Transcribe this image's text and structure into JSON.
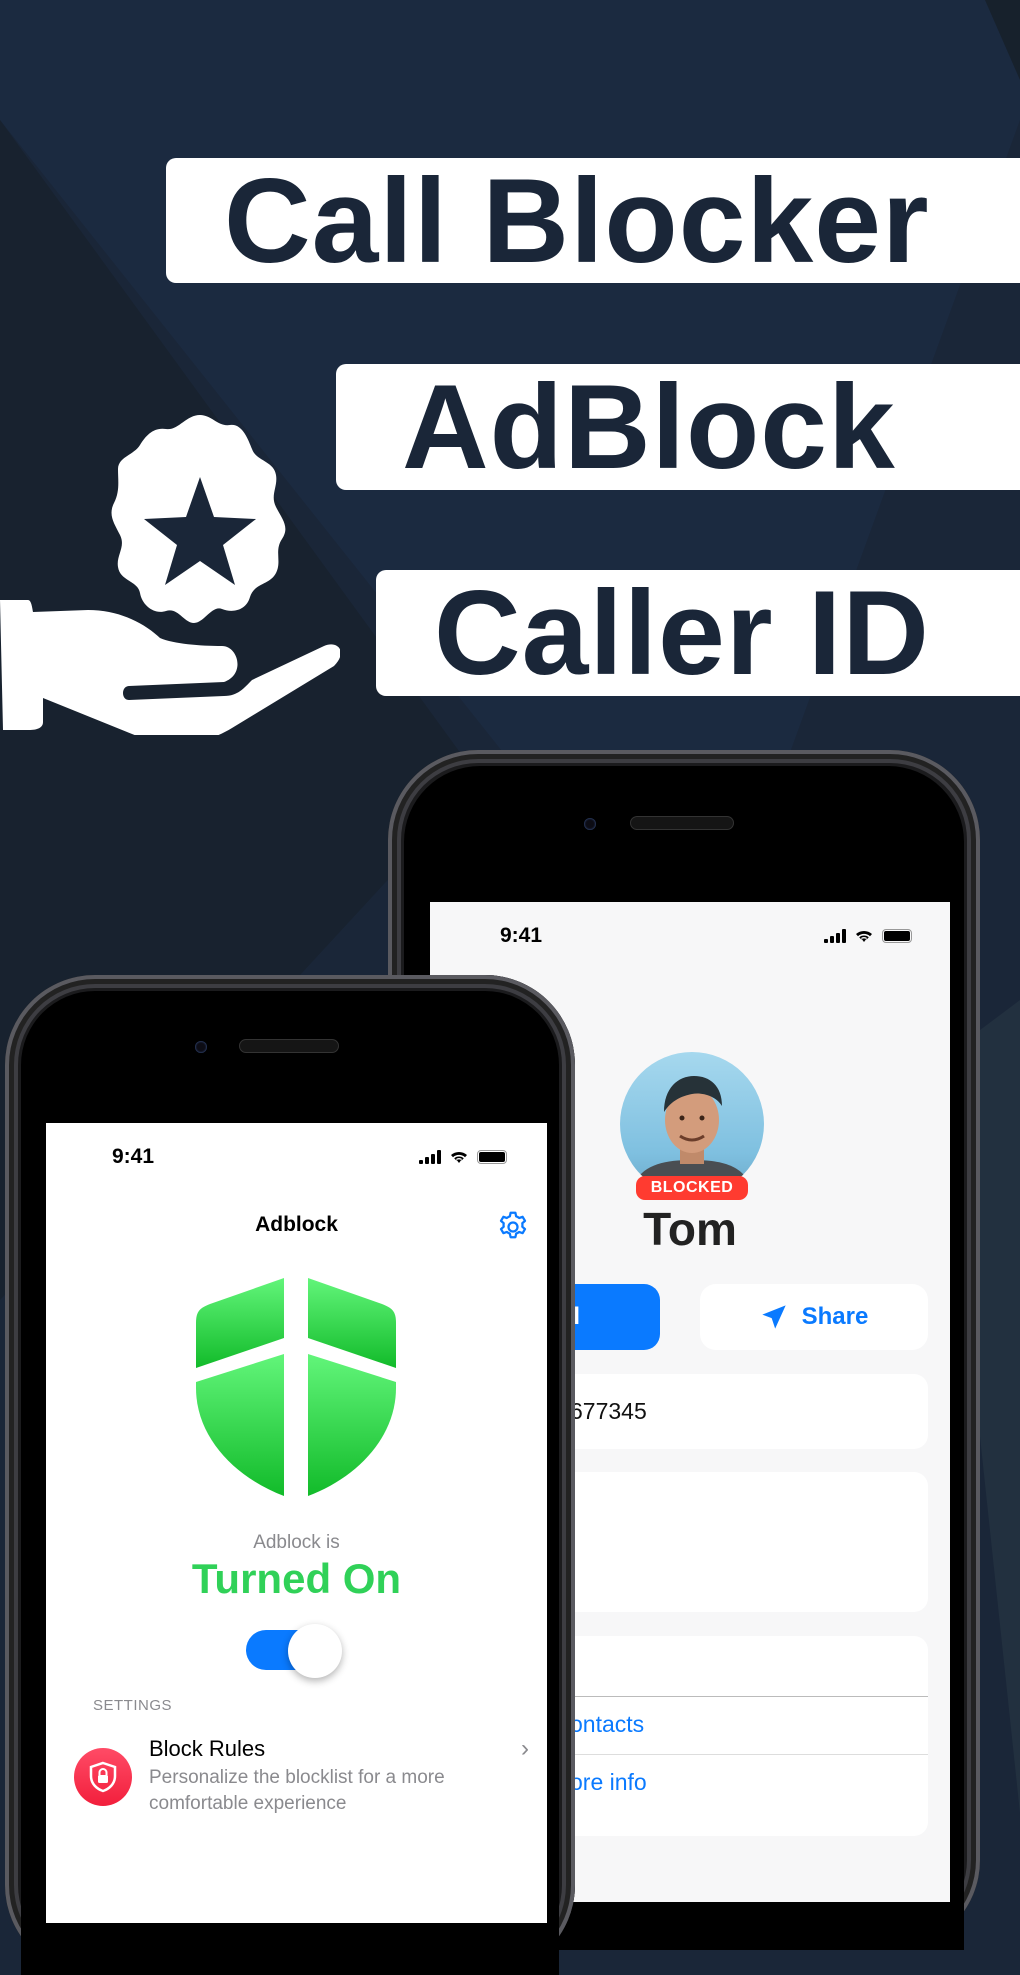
{
  "banner": {
    "lines": [
      "Call Blocker",
      "AdBlock",
      "Caller ID"
    ],
    "hero_icon": "hand-holding-star-badge-icon",
    "colors": {
      "background": "#1a2638",
      "band": "#ffffff",
      "text": "#1a2638"
    }
  },
  "caller_phone": {
    "status_time": "9:41",
    "contact": {
      "avatar": "person-photo",
      "badge": "BLOCKED",
      "name": "Tom"
    },
    "actions": {
      "call_label": "call",
      "share_label": "Share"
    },
    "phone_number_partial": "677345",
    "links": [
      "ontacts",
      "ore info"
    ],
    "colors": {
      "accent": "#0a7aff",
      "blocked": "#ff3b30"
    }
  },
  "adblock_phone": {
    "status_time": "9:41",
    "nav_title": "Adblock",
    "status_label": "Adblock is",
    "status_value": "Turned On",
    "toggle_on": true,
    "section_header": "SETTINGS",
    "settings": [
      {
        "icon": "shield-lock-icon",
        "title": "Block Rules",
        "subtitle": "Personalize the blocklist for a more comfortable experience"
      }
    ],
    "colors": {
      "on": "#30d158",
      "toggle": "#0a7aff",
      "rule_icon": "#f21f3c"
    }
  }
}
